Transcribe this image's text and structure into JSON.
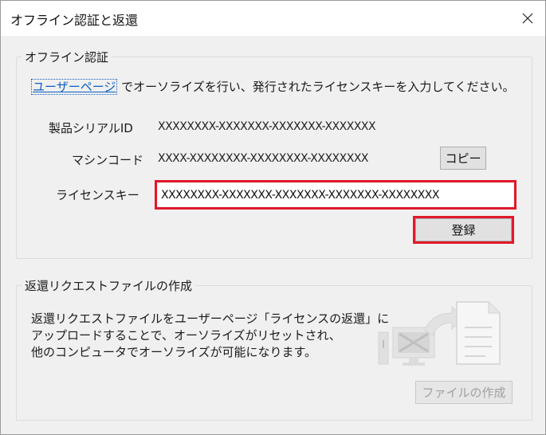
{
  "window": {
    "title": "オフライン認証と返還"
  },
  "offline_auth": {
    "legend": "オフライン認証",
    "link_text": "ユーザーページ",
    "instruction_rest": " でオーソライズを行い、発行されたライセンスキーを入力してください。",
    "serial_label": "製品シリアルID",
    "serial_value": "XXXXXXXX-XXXXXXX-XXXXXXX-XXXXXXX",
    "machine_label": "マシンコード",
    "machine_value": "XXXX-XXXXXXXX-XXXXXXXX-XXXXXXXX",
    "copy_label": "コピー",
    "key_label": "ライセンスキー",
    "key_value": "XXXXXXXX-XXXXXXX-XXXXXXX-XXXXXXX-XXXXXXXX",
    "register_label": "登録"
  },
  "return_request": {
    "legend": "返還リクエストファイルの作成",
    "desc_lines": [
      "返還リクエストファイルをユーザーページ「ライセンスの返還」に",
      "アップロードすることで、オーソライズがリセットされ、",
      "他のコンピュータでオーソライズが可能になります。"
    ],
    "create_label": "ファイルの作成"
  },
  "colors": {
    "highlight": "#e0192a",
    "link": "#0b5fc4"
  }
}
